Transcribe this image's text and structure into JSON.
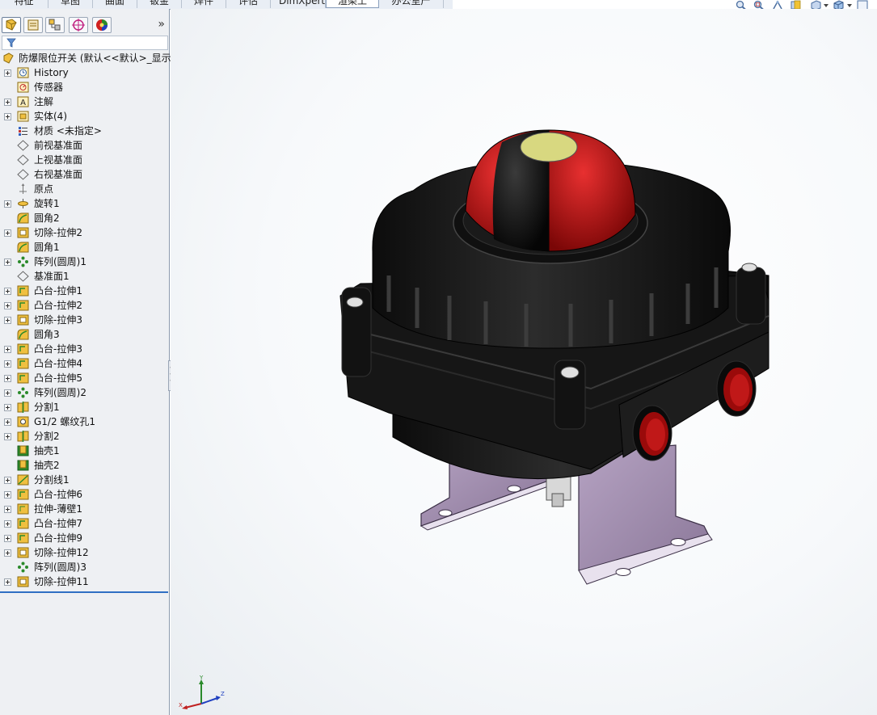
{
  "tabs": [
    {
      "label": "特征"
    },
    {
      "label": "草图"
    },
    {
      "label": "曲面"
    },
    {
      "label": "钣金"
    },
    {
      "label": "焊件"
    },
    {
      "label": "评估"
    },
    {
      "label": "DimXpert"
    },
    {
      "label": "渲染工具"
    },
    {
      "label": "办公室产品"
    }
  ],
  "active_tab": "渲染工具",
  "panel": {
    "more_label": "»",
    "tree": [
      {
        "label": "防爆限位开关  (默认<<默认>_显示",
        "icon": "part-icon"
      },
      {
        "label": "History",
        "icon": "history-icon"
      },
      {
        "label": "传感器",
        "icon": "sensor-icon"
      },
      {
        "label": "注解",
        "icon": "annotation-icon"
      },
      {
        "label": "实体(4)",
        "icon": "solid-bodies-icon"
      },
      {
        "label": "材质 <未指定>",
        "icon": "material-icon"
      },
      {
        "label": "前视基准面",
        "icon": "plane-icon"
      },
      {
        "label": "上视基准面",
        "icon": "plane-icon"
      },
      {
        "label": "右视基准面",
        "icon": "plane-icon"
      },
      {
        "label": "原点",
        "icon": "origin-icon"
      },
      {
        "label": "旋转1",
        "icon": "revolve-icon"
      },
      {
        "label": "圆角2",
        "icon": "fillet-icon"
      },
      {
        "label": "切除-拉伸2",
        "icon": "cut-extrude-icon"
      },
      {
        "label": "圆角1",
        "icon": "fillet-icon"
      },
      {
        "label": "阵列(圆周)1",
        "icon": "circular-pattern-icon"
      },
      {
        "label": "基准面1",
        "icon": "plane-icon"
      },
      {
        "label": "凸台-拉伸1",
        "icon": "boss-extrude-icon"
      },
      {
        "label": "凸台-拉伸2",
        "icon": "boss-extrude-icon"
      },
      {
        "label": "切除-拉伸3",
        "icon": "cut-extrude-icon"
      },
      {
        "label": "圆角3",
        "icon": "fillet-icon"
      },
      {
        "label": "凸台-拉伸3",
        "icon": "boss-extrude-icon"
      },
      {
        "label": "凸台-拉伸4",
        "icon": "boss-extrude-icon"
      },
      {
        "label": "凸台-拉伸5",
        "icon": "boss-extrude-icon"
      },
      {
        "label": "阵列(圆周)2",
        "icon": "circular-pattern-icon"
      },
      {
        "label": "分割1",
        "icon": "split-icon"
      },
      {
        "label": "G1/2 螺纹孔1",
        "icon": "hole-wizard-icon"
      },
      {
        "label": "分割2",
        "icon": "split-icon"
      },
      {
        "label": "抽壳1",
        "icon": "shell-icon"
      },
      {
        "label": "抽壳2",
        "icon": "shell-icon"
      },
      {
        "label": "分割线1",
        "icon": "split-line-icon"
      },
      {
        "label": "凸台-拉伸6",
        "icon": "boss-extrude-icon"
      },
      {
        "label": "拉伸-薄壁1",
        "icon": "thin-extrude-icon"
      },
      {
        "label": "凸台-拉伸7",
        "icon": "boss-extrude-icon"
      },
      {
        "label": "凸台-拉伸9",
        "icon": "boss-extrude-icon"
      },
      {
        "label": "切除-拉伸12",
        "icon": "cut-extrude-icon"
      },
      {
        "label": "阵列(圆周)3",
        "icon": "circular-pattern-icon"
      },
      {
        "label": "切除-拉伸11",
        "icon": "cut-extrude-icon"
      }
    ]
  },
  "triad": {
    "x": "X",
    "y": "Y",
    "z": "Z"
  },
  "colors": {
    "accent": "#2f6fc3",
    "housing": "#1c1c1c",
    "indicator_red": "#c01010",
    "indicator_cap": "#d8d880",
    "bracket": "#a48fb0"
  }
}
